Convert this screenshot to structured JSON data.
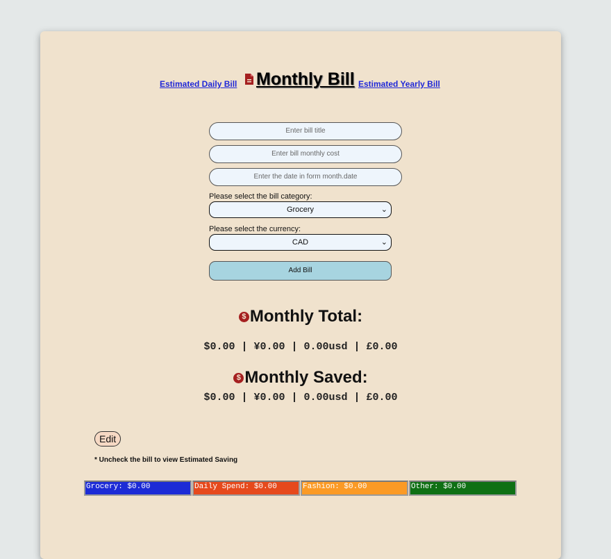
{
  "nav": {
    "daily_link": "Estimated Daily Bill",
    "title": "Monthly Bill",
    "yearly_link": "Estimated Yearly Bill"
  },
  "form": {
    "title_placeholder": "Enter bill title",
    "cost_placeholder": "Enter bill monthly cost",
    "date_placeholder": "Enter the date in form month.date",
    "category_label": "Please select the bill category:",
    "category_selected": "Grocery",
    "currency_label": "Please select the currency:",
    "currency_selected": "CAD",
    "add_button": "Add Bill"
  },
  "totals": {
    "monthly_total_heading": "Monthly Total:",
    "monthly_total_values": "$0.00 | ¥0.00 | 0.00usd | £0.00",
    "monthly_saved_heading": "Monthly Saved:",
    "monthly_saved_values": "$0.00 | ¥0.00 | 0.00usd | £0.00"
  },
  "edit_button": "Edit",
  "note": "* Uncheck the bill to view Estimated Saving",
  "categories": [
    {
      "label": "Grocery: $0.00",
      "color": "#1c2bd6"
    },
    {
      "label": "Daily Spend: $0.00",
      "color": "#e6491c"
    },
    {
      "label": "Fashion: $0.00",
      "color": "#fb9a25"
    },
    {
      "label": "Other: $0.00",
      "color": "#0f7014"
    }
  ],
  "colors": {
    "page_background": "#e4e8e8",
    "card_background": "#f0e2cd",
    "link": "#1f27d8",
    "accent_icon": "#a52020",
    "add_button": "#a7d4e0"
  },
  "icons": {
    "title_icon": "document-icon",
    "total_icon": "dollar-icon"
  }
}
